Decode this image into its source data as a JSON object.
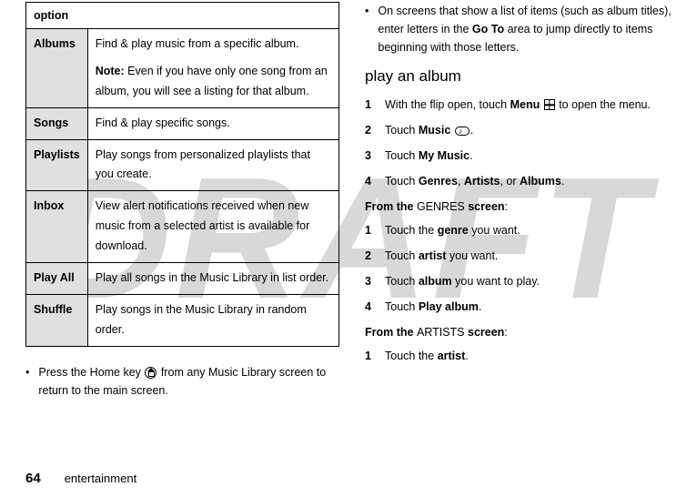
{
  "watermark": "DRAFT",
  "table": {
    "header": "option",
    "rows": [
      {
        "label": "Albums",
        "desc": "Find & play music from a specific album.",
        "note_prefix": "Note:",
        "note": " Even if you have only one song from an album, you will see a listing for that album."
      },
      {
        "label": "Songs",
        "desc": "Find & play specific songs."
      },
      {
        "label": "Playlists",
        "desc": "Play songs from personalized playlists that you create."
      },
      {
        "label": "Inbox",
        "desc": "View alert notifications received when new music from a selected artist is available for download."
      },
      {
        "label": "Play All",
        "desc": "Play all songs in the Music Library in list order."
      },
      {
        "label": "Shuffle",
        "desc": "Play songs in the Music Library in random order."
      }
    ]
  },
  "left_bullet": {
    "pre": "Press the Home key ",
    "post": " from any Music Library screen to return to the main screen."
  },
  "right_bullet": {
    "pre": "On screens that show a list of items (such as album titles), enter letters in the ",
    "bold": "Go To",
    "post": " area to jump directly to items beginning with those letters."
  },
  "section_title": "play an album",
  "steps_a": {
    "s1": {
      "pre": "With the flip open, touch ",
      "b1": "Menu",
      "post": " to open the menu."
    },
    "s2": {
      "pre": "Touch ",
      "b1": "Music",
      "post": "."
    },
    "s3": {
      "pre": "Touch ",
      "b1": "My Music",
      "post": "."
    },
    "s4": {
      "pre": "Touch ",
      "b1": "Genres",
      "mid1": ", ",
      "b2": "Artists",
      "mid2": ", or ",
      "b3": "Albums",
      "post": "."
    }
  },
  "from_genres": {
    "pre": "From the ",
    "b": "GENRES",
    "post": " screen",
    "colon": ":"
  },
  "steps_b": {
    "s1": {
      "pre": "Touch the ",
      "b": "genre",
      "post": " you want."
    },
    "s2": {
      "pre": "Touch ",
      "b": "artist",
      "post": " you want."
    },
    "s3": {
      "pre": "Touch ",
      "b": "album",
      "post": " you want to play."
    },
    "s4": {
      "pre": "Touch ",
      "b": "Play album",
      "post": "."
    }
  },
  "from_artists": {
    "pre": "From the ",
    "b": "ARTISTS",
    "post": " screen",
    "colon": ":"
  },
  "steps_c": {
    "s1": {
      "pre": "Touch the ",
      "b": "artist",
      "post": "."
    }
  },
  "footer": {
    "page": "64",
    "section": "entertainment"
  }
}
